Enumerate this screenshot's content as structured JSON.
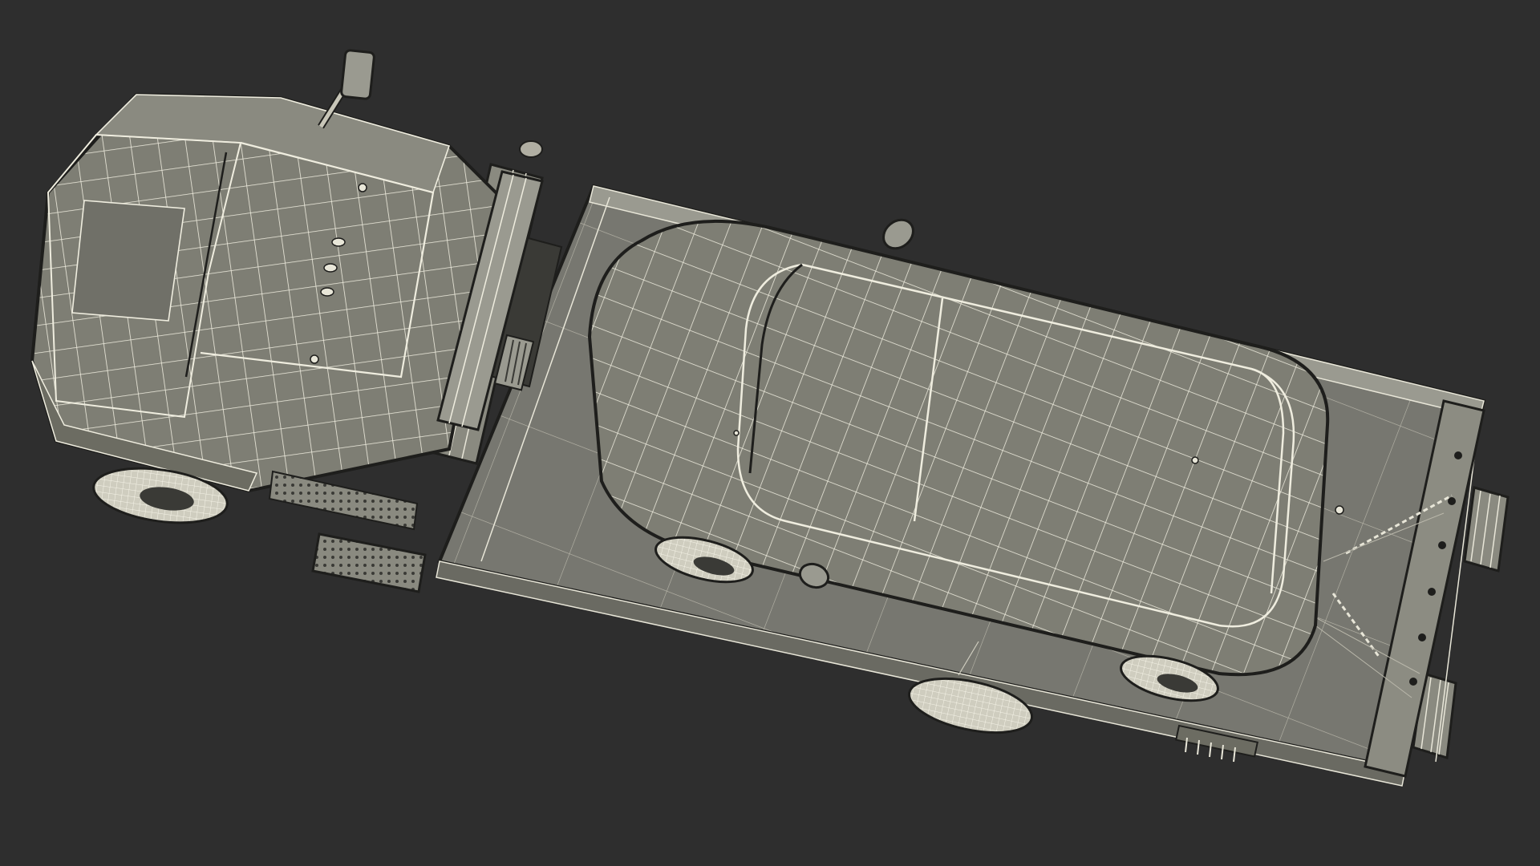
{
  "scene": {
    "subject": "flatbed-tow-truck-with-car-wireframe",
    "background_color": "#2e2e2e",
    "surface_color": "#7d7d72",
    "surface_dark_color": "#6c6c62",
    "wire_color": "#f2f0e4",
    "wire_dim_color": "#d8d6c8",
    "outline_color": "#1e1e1c"
  }
}
